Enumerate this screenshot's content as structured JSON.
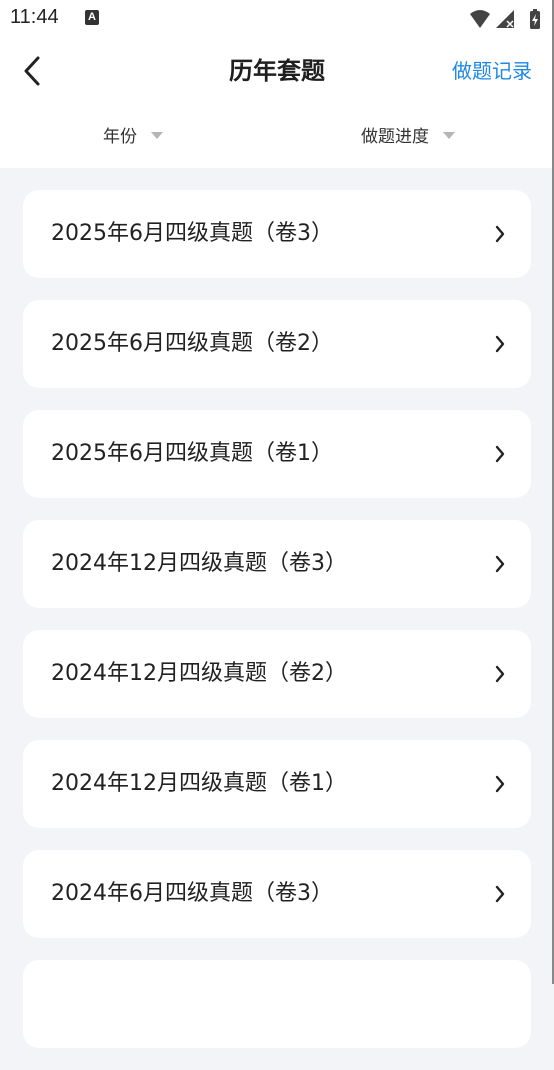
{
  "status_bar": {
    "time": "11:44",
    "notification_letter": "A",
    "icons": [
      "wifi-icon",
      "signal-icon",
      "battery-icon"
    ]
  },
  "header": {
    "title": "历年套题",
    "right_action": "做题记录",
    "back_icon": "chevron-left-icon"
  },
  "filters": {
    "year_label": "年份",
    "progress_label": "做题进度"
  },
  "papers": [
    "2025年6月四级真题（卷3）",
    "2025年6月四级真题（卷2）",
    "2025年6月四级真题（卷1）",
    "2024年12月四级真题（卷3）",
    "2024年12月四级真题（卷2）",
    "2024年12月四级真题（卷1）",
    "2024年6月四级真题（卷3）",
    ""
  ],
  "colors": {
    "accent": "#1e88e5",
    "background": "#f3f4f8",
    "card": "#ffffff",
    "text": "#222222"
  }
}
